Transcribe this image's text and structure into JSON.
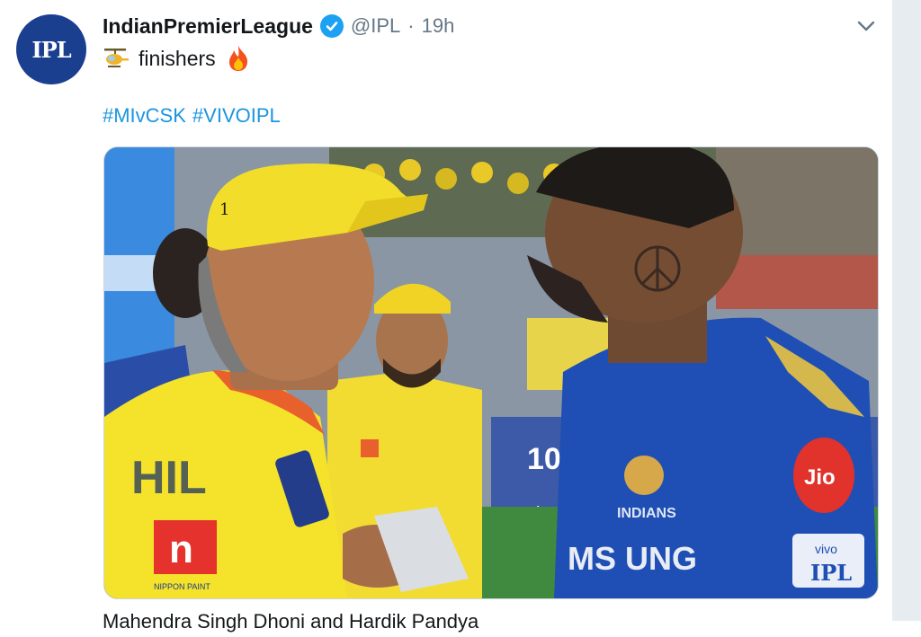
{
  "account": {
    "display_name": "IndianPremierLeague",
    "handle": "@IPL",
    "separator": "·",
    "time_ago": "19h",
    "avatar_text": "IPL",
    "verified": true
  },
  "tweet": {
    "text": "finishers",
    "emoji_leading": "helicopter-emoji",
    "emoji_trailing": "fire-emoji",
    "hashtags": [
      "#MIvCSK",
      "#VIVOIPL"
    ]
  },
  "media": {
    "jersey_left_sponsor": "HIL",
    "jersey_left_badge": "n",
    "jersey_left_badge_caption": "NIPPON PAINT",
    "cap_number": "1",
    "jersey_right_sponsor": "Jio",
    "jersey_right_team": "INDIANS",
    "jersey_right_chest": "MS UNG",
    "jersey_right_sleeve": "vivo",
    "jersey_right_sleeve_logo": "IPL",
    "board_text": "10",
    "board_text_small": "vivo"
  },
  "colors": {
    "link": "#1b95e0",
    "verified": "#1da1f2",
    "avatar_bg": "#1b3f8f",
    "csk_yellow": "#f5e22b",
    "mi_blue": "#1f4fb4"
  },
  "next_tweet": {
    "text": "Mahendra Singh Dhoni and Hardik Pandya"
  }
}
